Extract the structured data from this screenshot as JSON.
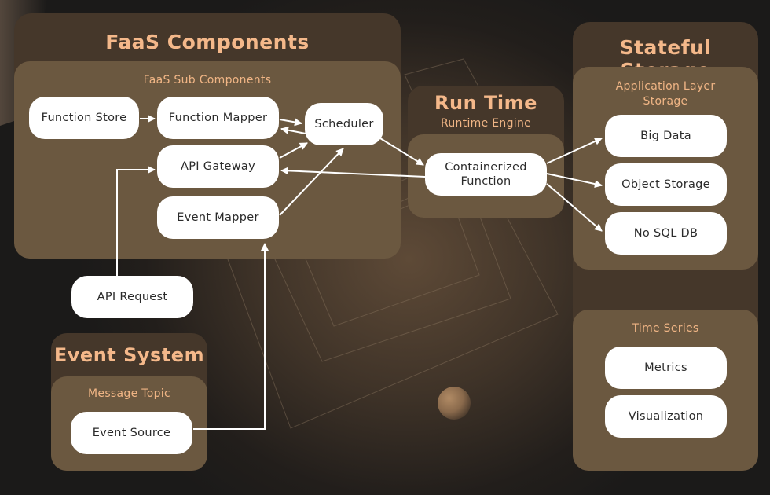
{
  "colors": {
    "title": "#f4b88a",
    "outer_panel": "#45372a",
    "inner_panel": "#6b5840",
    "node_fill": "#ffffff",
    "node_text": "#2b2b2b",
    "arrow": "#ffffff"
  },
  "faas": {
    "title": "FaaS Components",
    "subtitle": "FaaS Sub Components",
    "nodes": {
      "function_store": "Function Store",
      "function_mapper": "Function Mapper",
      "scheduler": "Scheduler",
      "api_gateway": "API Gateway",
      "event_mapper": "Event Mapper"
    }
  },
  "runtime": {
    "title": "Run Time",
    "subtitle": "Runtime Engine",
    "nodes": {
      "containerized_function_line1": "Containerized",
      "containerized_function_line2": "Function"
    }
  },
  "storage": {
    "title": "Stateful Storage",
    "app_layer": {
      "subtitle_line1": "Application Layer",
      "subtitle_line2": "Storage",
      "nodes": {
        "big_data": "Big Data",
        "object_storage": "Object Storage",
        "nosql_db": "No SQL DB"
      }
    },
    "time_series": {
      "subtitle": "Time Series",
      "nodes": {
        "metrics": "Metrics",
        "visualization": "Visualization"
      }
    }
  },
  "external": {
    "api_request": "API Request"
  },
  "event_system": {
    "title": "Event System",
    "subtitle": "Message Topic",
    "nodes": {
      "event_source": "Event Source"
    }
  },
  "edges": [
    {
      "from": "Function Store",
      "to": "Function Mapper"
    },
    {
      "from": "Function Mapper",
      "to": "Scheduler"
    },
    {
      "from": "Scheduler",
      "to": "Function Mapper"
    },
    {
      "from": "API Gateway",
      "to": "Scheduler"
    },
    {
      "from": "Event Mapper",
      "to": "Scheduler"
    },
    {
      "from": "Scheduler",
      "to": "Containerized Function"
    },
    {
      "from": "Containerized Function",
      "to": "API Gateway"
    },
    {
      "from": "API Request",
      "to": "API Gateway"
    },
    {
      "from": "Event Source",
      "to": "Event Mapper"
    },
    {
      "from": "Containerized Function",
      "to": "Big Data"
    },
    {
      "from": "Containerized Function",
      "to": "Object Storage"
    },
    {
      "from": "Containerized Function",
      "to": "No SQL DB"
    }
  ]
}
